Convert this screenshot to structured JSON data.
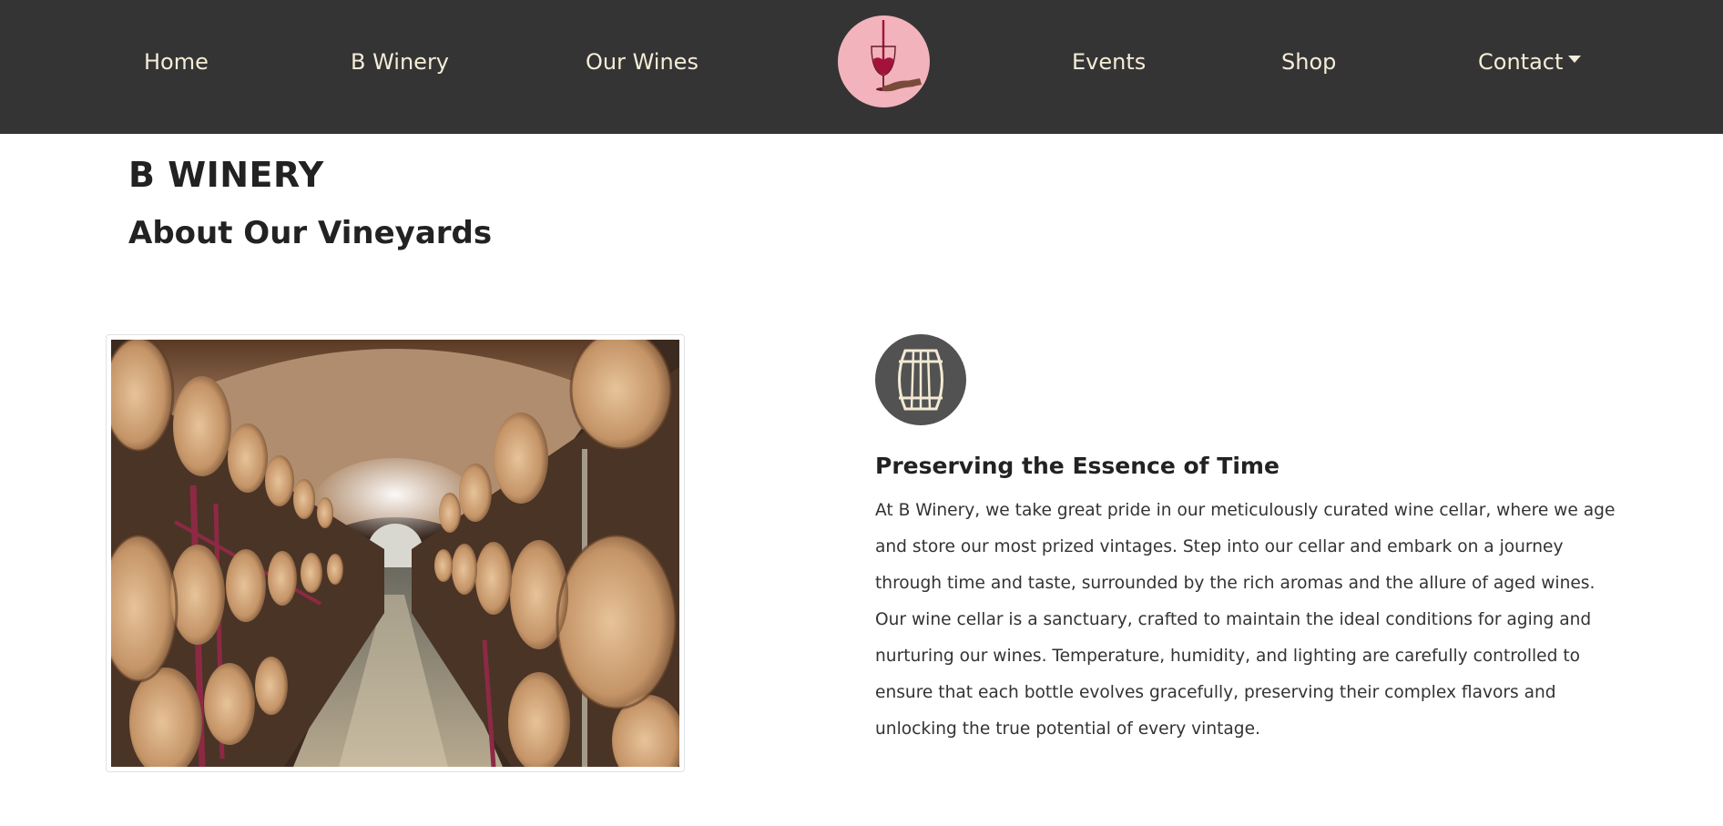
{
  "nav": {
    "items": [
      {
        "label": "Home"
      },
      {
        "label": "B Winery"
      },
      {
        "label": "Our Wines"
      },
      {
        "label": "Events"
      },
      {
        "label": "Shop"
      },
      {
        "label": "Contact"
      }
    ],
    "logo_icon": "wine-glass-hand-icon"
  },
  "header": {
    "title": "B WINERY",
    "subtitle": "About Our Vineyards"
  },
  "feature": {
    "icon": "barrel-icon",
    "heading": "Preserving the Essence of Time",
    "body": "At B Winery, we take great pride in our meticulously curated wine cellar, where we age and store our most prized vintages. Step into our cellar and embark on a journey through time and taste, surrounded by the rich aromas and the allure of aged wines. Our wine cellar is a sanctuary, crafted to maintain the ideal conditions for aging and nurturing our wines. Temperature, humidity, and lighting are carefully controlled to ensure that each bottle evolves gracefully, preserving their complex flavors and unlocking the true potential of every vintage."
  },
  "colors": {
    "navbar_bg": "#343434",
    "nav_text": "#f5ecd8",
    "logo_bg": "#f2b3bc",
    "wine_red": "#a3123a",
    "barrel_circle": "#525252"
  }
}
